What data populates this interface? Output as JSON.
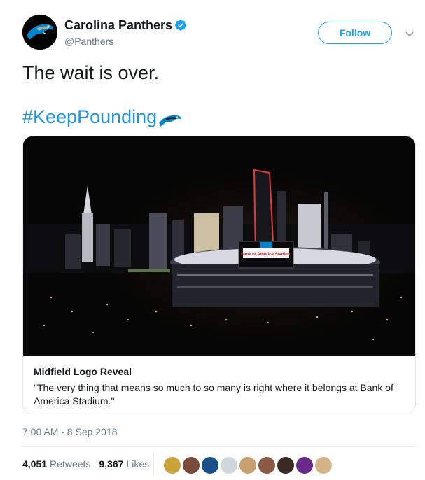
{
  "header": {
    "name": "Carolina Panthers",
    "handle": "@Panthers",
    "follow_label": "Follow"
  },
  "tweet": {
    "text": "The wait is over.",
    "hashtag": "#KeepPounding"
  },
  "card": {
    "title": "Midfield Logo Reveal",
    "description": "\"The very thing that means so much to so many is right where it belongs at Bank of America Stadium.\"",
    "stadium_sign": "Bank of America Stadium"
  },
  "meta": {
    "timestamp": "7:00 AM - 8 Sep 2018",
    "retweets_count": "4,051",
    "retweets_label": "Retweets",
    "likes_count": "9,367",
    "likes_label": "Likes"
  },
  "colors": {
    "accent": "#1da1f2",
    "hashtag": "#1b95e0",
    "panthers_blue": "#0085ca",
    "verified": "#1da1f2"
  },
  "icons": {
    "verified": "verified-badge-icon",
    "chevron": "chevron-down-icon",
    "hashtag_emoji": "panther-emoji-icon"
  },
  "liker_avatars": [
    "#c9a33b",
    "#7a4b3a",
    "#1b4f8a",
    "#cfd6dc",
    "#c8a070",
    "#8a5a44",
    "#3b2a22",
    "#6a2a8a",
    "#d6b48a"
  ]
}
